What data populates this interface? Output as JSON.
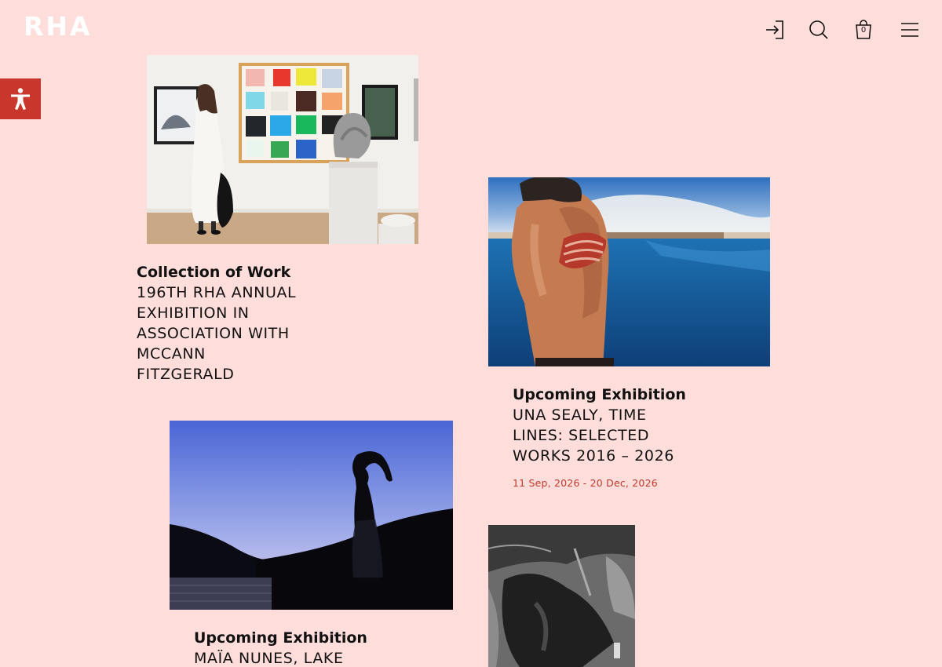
{
  "header": {
    "logo": "RHA",
    "cart_count": "0",
    "icons": [
      "login-icon",
      "search-icon",
      "basket-icon",
      "hamburger-menu-icon"
    ]
  },
  "accessibility": {
    "icon": "accessibility-icon",
    "color": "#c8362c"
  },
  "cards": [
    {
      "kicker": "Collection of Work",
      "title_lines": [
        "196TH RHA ANNUAL",
        "EXHIBITION IN",
        "ASSOCIATION WITH",
        "MCCANN",
        "FITZGERALD"
      ]
    },
    {
      "kicker": "Upcoming Exhibition",
      "title_lines": [
        "UNA SEALY, TIME",
        "LINES: SELECTED",
        "WORKS 2016 – 2026"
      ],
      "dates": "11 Sep, 2026 - 20 Dec, 2026"
    },
    {
      "kicker": "Upcoming Exhibition",
      "title_lines": [
        "MAÏA NUNES, LAKE"
      ]
    }
  ],
  "colors": {
    "background": "#ffdddb",
    "accent": "#c8362c",
    "date_text": "#c33a2f"
  }
}
